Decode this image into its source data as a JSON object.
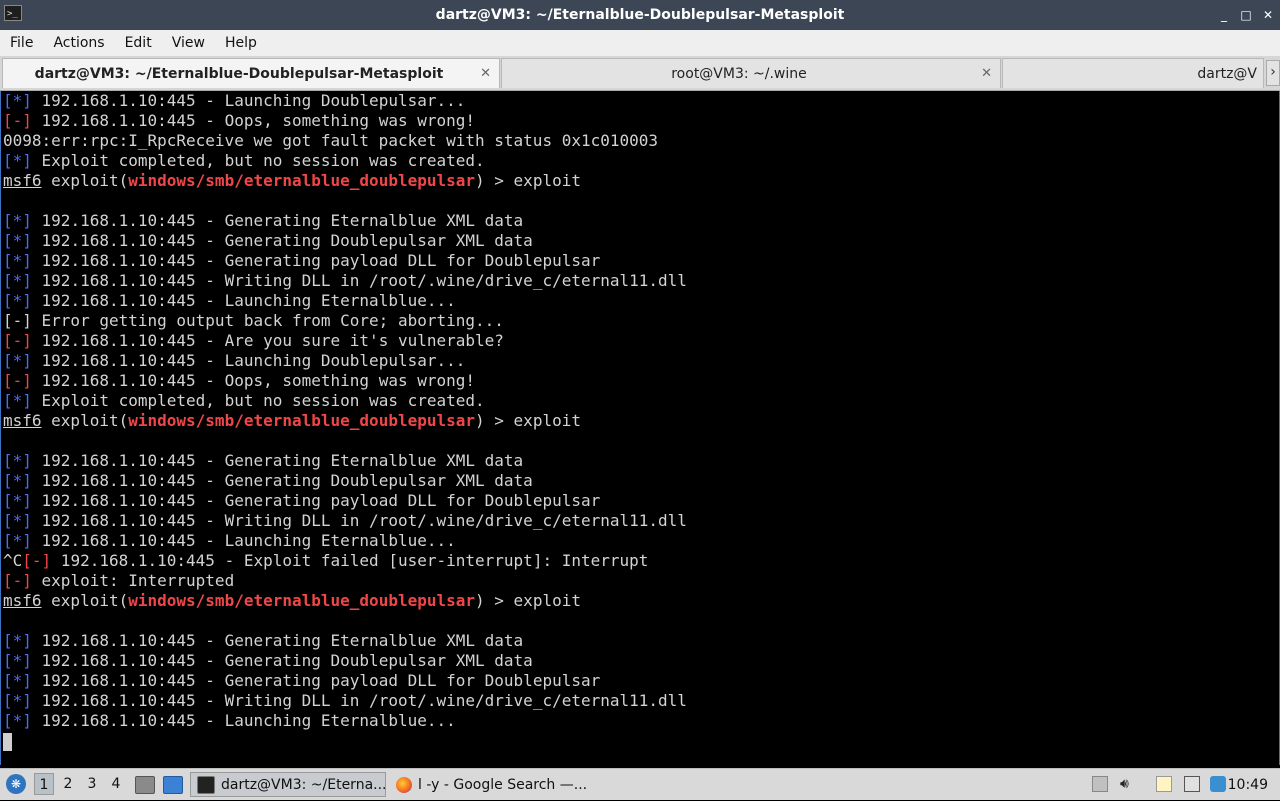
{
  "window": {
    "title": "dartz@VM3: ~/Eternalblue-Doublepulsar-Metasploit",
    "app_icon": ">_",
    "minimize": "_",
    "maximize": "□",
    "close": "✕"
  },
  "menu": [
    "File",
    "Actions",
    "Edit",
    "View",
    "Help"
  ],
  "tabs": [
    {
      "label": "dartz@VM3: ~/Eternalblue-Doublepulsar-Metasploit",
      "active": true,
      "close": "✕"
    },
    {
      "label": "root@VM3: ~/.wine",
      "active": false,
      "close": "✕"
    },
    {
      "label": "dartz@V",
      "active": false,
      "close": ""
    }
  ],
  "tab_scroll": "›",
  "terminal": {
    "lines": [
      [
        {
          "t": "[*]",
          "c": "blue"
        },
        {
          "t": " 192.168.1.10:445 - Launching Doublepulsar...",
          "c": ""
        }
      ],
      [
        {
          "t": "[-]",
          "c": "red"
        },
        {
          "t": " 192.168.1.10:445 - Oops, something was wrong!",
          "c": ""
        }
      ],
      [
        {
          "t": "0098:err:rpc:I_RpcReceive we got fault packet with status 0x1c010003",
          "c": ""
        }
      ],
      [
        {
          "t": "[*]",
          "c": "blue"
        },
        {
          "t": " Exploit completed, but no session was created.",
          "c": ""
        }
      ],
      [
        {
          "t": "msf6",
          "c": "ul"
        },
        {
          "t": " exploit(",
          "c": ""
        },
        {
          "t": "windows/smb/eternalblue_doublepulsar",
          "c": "redb"
        },
        {
          "t": ") > exploit",
          "c": ""
        }
      ],
      [],
      [
        {
          "t": "[*]",
          "c": "blue"
        },
        {
          "t": " 192.168.1.10:445 - Generating Eternalblue XML data",
          "c": ""
        }
      ],
      [
        {
          "t": "[*]",
          "c": "blue"
        },
        {
          "t": " 192.168.1.10:445 - Generating Doublepulsar XML data",
          "c": ""
        }
      ],
      [
        {
          "t": "[*]",
          "c": "blue"
        },
        {
          "t": " 192.168.1.10:445 - Generating payload DLL for Doublepulsar",
          "c": ""
        }
      ],
      [
        {
          "t": "[*]",
          "c": "blue"
        },
        {
          "t": " 192.168.1.10:445 - Writing DLL in /root/.wine/drive_c/eternal11.dll",
          "c": ""
        }
      ],
      [
        {
          "t": "[*]",
          "c": "blue"
        },
        {
          "t": " 192.168.1.10:445 - Launching Eternalblue...",
          "c": ""
        }
      ],
      [
        {
          "t": "[-] Error getting output back from Core; aborting...",
          "c": ""
        }
      ],
      [
        {
          "t": "[-]",
          "c": "red"
        },
        {
          "t": " 192.168.1.10:445 - Are you sure it's vulnerable?",
          "c": ""
        }
      ],
      [
        {
          "t": "[*]",
          "c": "blue"
        },
        {
          "t": " 192.168.1.10:445 - Launching Doublepulsar...",
          "c": ""
        }
      ],
      [
        {
          "t": "[-]",
          "c": "red"
        },
        {
          "t": " 192.168.1.10:445 - Oops, something was wrong!",
          "c": ""
        }
      ],
      [
        {
          "t": "[*]",
          "c": "blue"
        },
        {
          "t": " Exploit completed, but no session was created.",
          "c": ""
        }
      ],
      [
        {
          "t": "msf6",
          "c": "ul"
        },
        {
          "t": " exploit(",
          "c": ""
        },
        {
          "t": "windows/smb/eternalblue_doublepulsar",
          "c": "redb"
        },
        {
          "t": ") > exploit",
          "c": ""
        }
      ],
      [],
      [
        {
          "t": "[*]",
          "c": "blue"
        },
        {
          "t": " 192.168.1.10:445 - Generating Eternalblue XML data",
          "c": ""
        }
      ],
      [
        {
          "t": "[*]",
          "c": "blue"
        },
        {
          "t": " 192.168.1.10:445 - Generating Doublepulsar XML data",
          "c": ""
        }
      ],
      [
        {
          "t": "[*]",
          "c": "blue"
        },
        {
          "t": " 192.168.1.10:445 - Generating payload DLL for Doublepulsar",
          "c": ""
        }
      ],
      [
        {
          "t": "[*]",
          "c": "blue"
        },
        {
          "t": " 192.168.1.10:445 - Writing DLL in /root/.wine/drive_c/eternal11.dll",
          "c": ""
        }
      ],
      [
        {
          "t": "[*]",
          "c": "blue"
        },
        {
          "t": " 192.168.1.10:445 - Launching Eternalblue...",
          "c": ""
        }
      ],
      [
        {
          "t": "^C",
          "c": ""
        },
        {
          "t": "[-]",
          "c": "red"
        },
        {
          "t": " 192.168.1.10:445 - Exploit failed [user-interrupt]: Interrupt",
          "c": ""
        }
      ],
      [
        {
          "t": "[-]",
          "c": "red"
        },
        {
          "t": " exploit: Interrupted",
          "c": ""
        }
      ],
      [
        {
          "t": "msf6",
          "c": "ul"
        },
        {
          "t": " exploit(",
          "c": ""
        },
        {
          "t": "windows/smb/eternalblue_doublepulsar",
          "c": "redb"
        },
        {
          "t": ") > exploit",
          "c": ""
        }
      ],
      [],
      [
        {
          "t": "[*]",
          "c": "blue"
        },
        {
          "t": " 192.168.1.10:445 - Generating Eternalblue XML data",
          "c": ""
        }
      ],
      [
        {
          "t": "[*]",
          "c": "blue"
        },
        {
          "t": " 192.168.1.10:445 - Generating Doublepulsar XML data",
          "c": ""
        }
      ],
      [
        {
          "t": "[*]",
          "c": "blue"
        },
        {
          "t": " 192.168.1.10:445 - Generating payload DLL for Doublepulsar",
          "c": ""
        }
      ],
      [
        {
          "t": "[*]",
          "c": "blue"
        },
        {
          "t": " 192.168.1.10:445 - Writing DLL in /root/.wine/drive_c/eternal11.dll",
          "c": ""
        }
      ],
      [
        {
          "t": "[*]",
          "c": "blue"
        },
        {
          "t": " 192.168.1.10:445 - Launching Eternalblue...",
          "c": ""
        }
      ]
    ],
    "colors": {
      "blue": "#4b6bf0",
      "red": "#ef4747",
      "fg": "#d3d3d3",
      "bg": "#000000"
    }
  },
  "taskbar": {
    "start_icon": "start-menu-icon",
    "workspaces": [
      "1",
      "2",
      "3",
      "4"
    ],
    "active_workspace": "1",
    "tasks": [
      {
        "label": "dartz@VM3: ~/Eterna...",
        "icon": "terminal-icon",
        "active": true
      },
      {
        "label": "l -y - Google Search —...",
        "icon": "firefox-icon",
        "active": false
      }
    ],
    "clock": "10:49"
  }
}
